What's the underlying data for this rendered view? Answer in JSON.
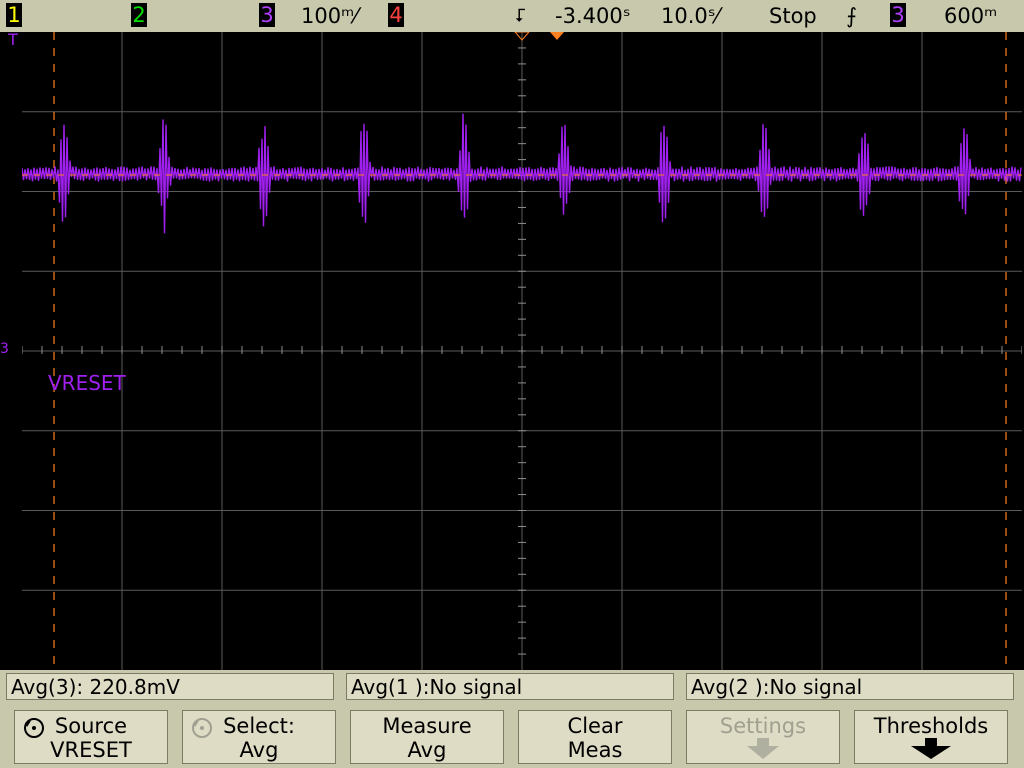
{
  "topbar": {
    "ch1": "1",
    "ch2": "2",
    "ch3": "3",
    "ch3_scale": "100ᵐ⁄",
    "ch4": "4",
    "delay": "-3.400ˢ",
    "timebase": "10.0ˢ⁄",
    "run_state": "Stop",
    "trigger_slope": "⨍",
    "trigger_source": "3",
    "trigger_level": "600ᵐ"
  },
  "screen": {
    "trace_label": "VRESET",
    "ch3_marker": "3",
    "trigger_marker": "T",
    "colors": {
      "ch3": "#a020f0",
      "cursor": "#ff8020",
      "grid": "#808080"
    }
  },
  "measurements": [
    {
      "text": "Avg(3): 220.8mV"
    },
    {
      "text": "Avg(1 ):No signal"
    },
    {
      "text": "Avg(2 ):No signal"
    }
  ],
  "softkeys": [
    {
      "line1": "Source",
      "line2": "VRESET",
      "icon": "rotate-knob-icon"
    },
    {
      "line1": "Select:",
      "line2": "Avg",
      "icon": "rotate-knob-icon"
    },
    {
      "line1": "Measure",
      "line2": "Avg"
    },
    {
      "line1": "Clear",
      "line2": "Meas"
    },
    {
      "line1": "Settings",
      "line2": "",
      "icon": "down-arrow-icon"
    },
    {
      "line1": "Thresholds",
      "line2": "",
      "icon": "down-arrow-icon"
    }
  ]
}
